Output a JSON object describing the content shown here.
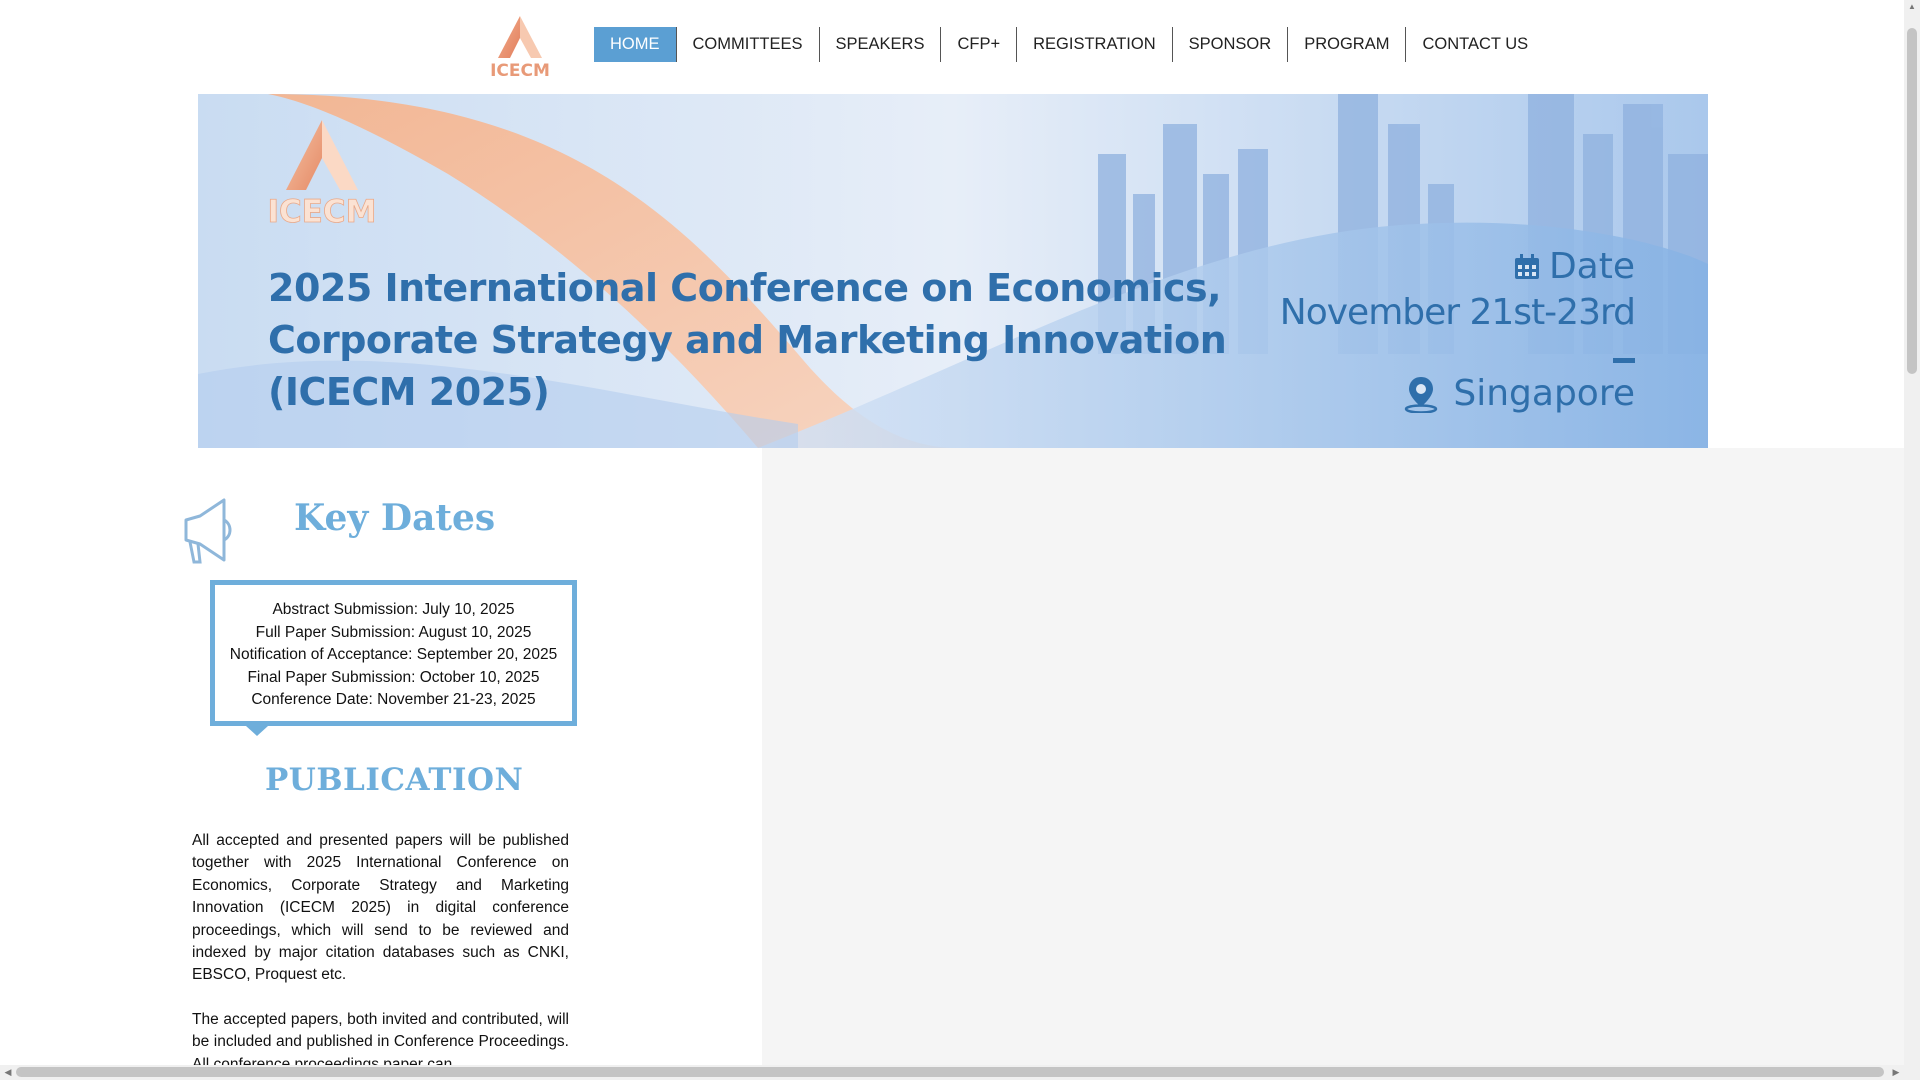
{
  "header": {
    "logo_text": "ICECM",
    "nav": [
      {
        "label": "HOME"
      },
      {
        "label": "COMMITTEES"
      },
      {
        "label": "SPEAKERS"
      },
      {
        "label": "CFP+"
      },
      {
        "label": "REGISTRATION"
      },
      {
        "label": "SPONSOR"
      },
      {
        "label": "PROGRAM"
      },
      {
        "label": "CONTACT US"
      }
    ],
    "active_index": 0
  },
  "banner": {
    "logo_text": "ICECM",
    "title_lines": [
      "2025 International Conference on Economics,",
      "Corporate Strategy and Marketing Innovation",
      "(ICECM 2025)"
    ],
    "date_label": "Date",
    "date_value": "November 21st-23rd",
    "location": "Singapore",
    "icons": [
      "calendar-icon",
      "location-pin-icon"
    ]
  },
  "key_dates": {
    "title": "Key Dates",
    "items": [
      "Abstract Submission: July 10, 2025",
      "Full Paper Submission: August 10, 2025",
      "Notification of Acceptance: September 20, 2025",
      "Final Paper Submission: October 10, 2025",
      "Conference Date: November 21-23, 2025"
    ]
  },
  "publication": {
    "title": "PUBLICATION",
    "paragraphs": [
      "All accepted and presented papers will be published together with 2025 International Conference on Economics, Corporate Strategy and Marketing Innovation (ICECM 2025) in digital conference proceedings, which will send to be reviewed and indexed by major citation databases such as CNKI, EBSCO, Proquest etc.",
      "The accepted papers, both invited and contributed, will be included and published in Conference Proceedings. All conference proceedings paper can"
    ]
  },
  "colors": {
    "accent": "#5b9fd3",
    "heading": "#6eaedb",
    "banner_text": "#2f6fab",
    "logo": "#e89a78"
  }
}
